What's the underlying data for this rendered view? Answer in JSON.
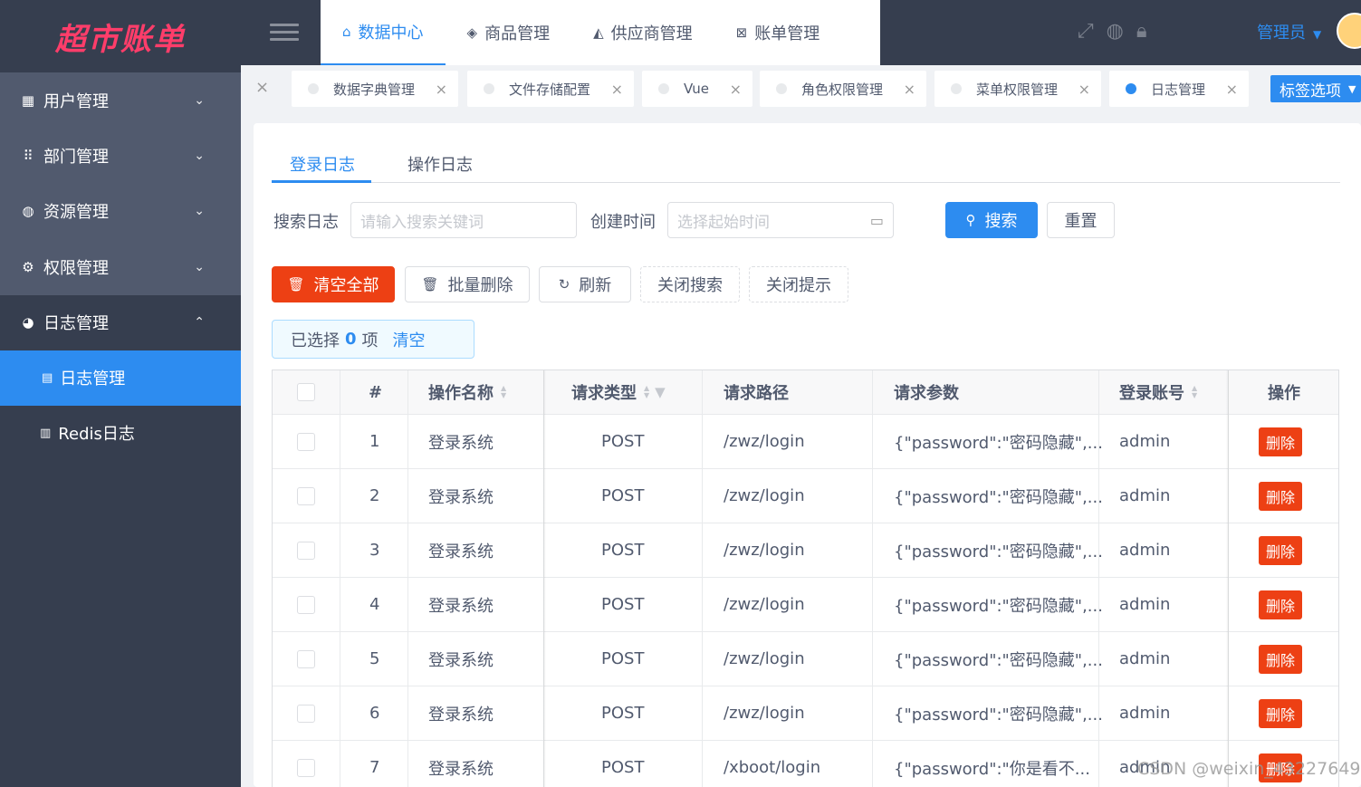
{
  "app": {
    "logo_text": "超市账单"
  },
  "sidebar": {
    "items": [
      {
        "label": "用户管理",
        "icon": "chart-icon",
        "chev": "⌄"
      },
      {
        "label": "部门管理",
        "icon": "grid-icon",
        "chev": "⌄"
      },
      {
        "label": "资源管理",
        "icon": "globe-icon",
        "chev": "⌄"
      },
      {
        "label": "权限管理",
        "icon": "gear-icon",
        "chev": "⌄"
      },
      {
        "label": "日志管理",
        "icon": "pie-icon",
        "chev": "⌃"
      }
    ],
    "sub_items": [
      {
        "label": "日志管理",
        "active": true
      },
      {
        "label": "Redis日志",
        "active": false
      }
    ]
  },
  "header": {
    "nav": [
      {
        "label": "数据中心",
        "active": true
      },
      {
        "label": "商品管理",
        "active": false
      },
      {
        "label": "供应商管理",
        "active": false
      },
      {
        "label": "账单管理",
        "active": false
      }
    ],
    "user": "管理员"
  },
  "tabs": [
    {
      "label": "数据字典管理",
      "active": false
    },
    {
      "label": "文件存储配置",
      "active": false
    },
    {
      "label": "Vue",
      "active": false
    },
    {
      "label": "角色权限管理",
      "active": false
    },
    {
      "label": "菜单权限管理",
      "active": false
    },
    {
      "label": "日志管理",
      "active": true
    }
  ],
  "tag_options_label": "标签选项",
  "subtabs": [
    {
      "label": "登录日志",
      "active": true
    },
    {
      "label": "操作日志",
      "active": false
    }
  ],
  "search": {
    "label": "搜索日志",
    "placeholder": "请输入搜索关键词",
    "time_label": "创建时间",
    "time_placeholder": "选择起始时间",
    "search_btn": "搜索",
    "reset_btn": "重置"
  },
  "actions": {
    "clear_all": "清空全部",
    "batch_delete": "批量删除",
    "refresh": "刷新",
    "close_search": "关闭搜索",
    "close_tip": "关闭提示"
  },
  "selection": {
    "prefix": "已选择",
    "count": "0",
    "suffix": "项",
    "clear": "清空"
  },
  "table": {
    "headers": {
      "index": "#",
      "name": "操作名称",
      "type": "请求类型",
      "path": "请求路径",
      "params": "请求参数",
      "account": "登录账号",
      "op": "操作"
    },
    "rows": [
      {
        "index": "1",
        "name": "登录系统",
        "type": "POST",
        "path": "/zwz/login",
        "params": "{\"password\":\"密码隐藏\",...",
        "account": "admin",
        "op": "删除"
      },
      {
        "index": "2",
        "name": "登录系统",
        "type": "POST",
        "path": "/zwz/login",
        "params": "{\"password\":\"密码隐藏\",...",
        "account": "admin",
        "op": "删除"
      },
      {
        "index": "3",
        "name": "登录系统",
        "type": "POST",
        "path": "/zwz/login",
        "params": "{\"password\":\"密码隐藏\",...",
        "account": "admin",
        "op": "删除"
      },
      {
        "index": "4",
        "name": "登录系统",
        "type": "POST",
        "path": "/zwz/login",
        "params": "{\"password\":\"密码隐藏\",...",
        "account": "admin",
        "op": "删除"
      },
      {
        "index": "5",
        "name": "登录系统",
        "type": "POST",
        "path": "/zwz/login",
        "params": "{\"password\":\"密码隐藏\",...",
        "account": "admin",
        "op": "删除"
      },
      {
        "index": "6",
        "name": "登录系统",
        "type": "POST",
        "path": "/zwz/login",
        "params": "{\"password\":\"密码隐藏\",...",
        "account": "admin",
        "op": "删除"
      },
      {
        "index": "7",
        "name": "登录系统",
        "type": "POST",
        "path": "/xboot/login",
        "params": "{\"password\":\"你是看不...",
        "account": "admin",
        "op": "删除"
      }
    ]
  },
  "watermark": "CSDN @weixin_43227649",
  "colors": {
    "primary": "#2d8cf0",
    "danger": "#ed4014",
    "sidebar": "#363e4f"
  }
}
